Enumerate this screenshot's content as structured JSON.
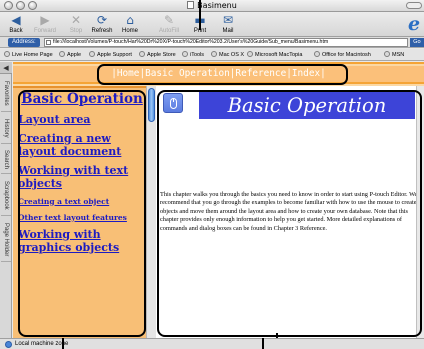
{
  "window": {
    "title": "Basimenu"
  },
  "toolbar": {
    "buttons": [
      {
        "label": "Back",
        "icon": "back-arrow-icon",
        "enabled": true
      },
      {
        "label": "Forward",
        "icon": "forward-arrow-icon",
        "enabled": false
      },
      {
        "label": "Stop",
        "icon": "stop-icon",
        "enabled": false
      },
      {
        "label": "Refresh",
        "icon": "refresh-icon",
        "enabled": true
      },
      {
        "label": "Home",
        "icon": "home-icon",
        "enabled": true
      },
      {
        "label": "AutoFill",
        "icon": "autofill-icon",
        "enabled": false
      },
      {
        "label": "Print",
        "icon": "print-icon",
        "enabled": true
      },
      {
        "label": "Mail",
        "icon": "mail-icon",
        "enabled": true
      }
    ]
  },
  "address": {
    "label": "Address:",
    "url": "file:///localhost/Volumes/P-touch/Har%20Dr%20X/P-touch%20Editor%203.2/User's%20Guide/Sub_menu/Basimenu.htm",
    "go_label": "Go"
  },
  "favorites": [
    "Live Home Page",
    "Apple",
    "Apple Support",
    "Apple Store",
    "iTools",
    "Mac OS X",
    "Microsoft MacTopia",
    "Office for Macintosh",
    "MSN"
  ],
  "sidetabs": [
    "Favorites",
    "History",
    "Search",
    "Scrapbook",
    "Page Holder"
  ],
  "nav": {
    "left": "|",
    "home": "Home",
    "basic": "Basic Operation",
    "reference": "Reference",
    "index": "Index",
    "sep": "|",
    "right": "|"
  },
  "toc": {
    "title": "Basic Operation",
    "items": [
      {
        "label": "Layout area",
        "size": "big"
      },
      {
        "label": "Creating a new layout document",
        "size": "big"
      },
      {
        "label": "Working with text objects",
        "size": "big"
      },
      {
        "label": "Creating a text object",
        "size": "small"
      },
      {
        "label": "Other text layout features",
        "size": "small"
      },
      {
        "label": "Working with graphics objects",
        "size": "big"
      }
    ]
  },
  "main": {
    "heading": "Basic Operation",
    "body": "This chapter walks you through the basics you need to know in order to start using P-touch Editor. We recommend that you go through the examples to become familiar with how to use the mouse to create objects and move them around the layout area and how to create your own database. Note that this chapter provides only enough information to help you get started. More detailed explanations of commands and dialog boxes can be found in Chapter 3 Reference."
  },
  "status": {
    "text": "Local machine zone"
  },
  "colors": {
    "accent_orange": "#f5a436",
    "toc_bg": "#f8bf76",
    "link_blue": "#1d1bc2",
    "heading_bg": "#3d44d8"
  }
}
